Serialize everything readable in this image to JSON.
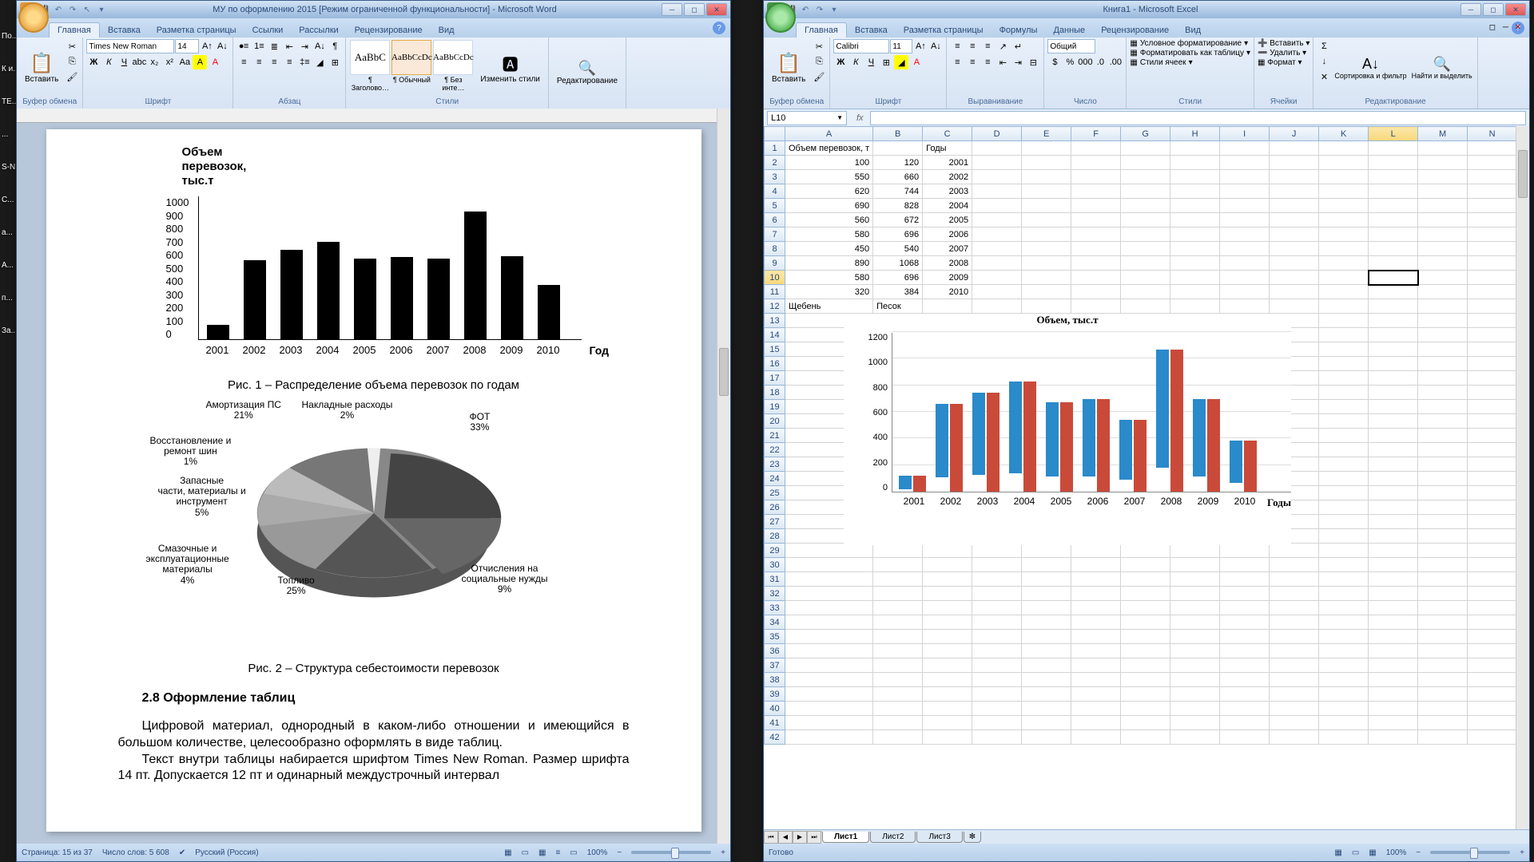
{
  "word": {
    "title": "МУ по оформлению 2015 [Режим ограниченной функциональности] - Microsoft Word",
    "tabs": [
      "Главная",
      "Вставка",
      "Разметка страницы",
      "Ссылки",
      "Рассылки",
      "Рецензирование",
      "Вид"
    ],
    "active_tab": 0,
    "ribbon": {
      "paste": "Вставить",
      "clipboard": "Буфер обмена",
      "font_name": "Times New Roman",
      "font_size": "14",
      "font": "Шрифт",
      "paragraph": "Абзац",
      "styles": "Стили",
      "style_heading": "¶ Заголово…",
      "style_normal": "¶ Обычный",
      "style_nospacing": "¶ Без инте…",
      "change_styles": "Изменить стили",
      "editing": "Редактирование"
    },
    "doc": {
      "chart1_title_lines": [
        "Объем",
        "перевозок,",
        "тыс.т"
      ],
      "chart1_ymax": 1000,
      "chart1_xlabel": "Год",
      "fig1_caption": "Рис. 1 – Распределение объема перевозок по годам",
      "pie_labels": {
        "amort": "Амортизация ПС\n21%",
        "overhead": "Накладные расходы\n2%",
        "fot": "ФОТ\n33%",
        "tires": "Восстановление и\nремонт шин\n1%",
        "parts": "Запасные\nчасти, материалы и\nинструмент\n5%",
        "lube": "Смазочные и\nэксплуатационные\nматериалы\n4%",
        "fuel": "Топливо\n25%",
        "social": "Отчисления на\nсоциальные нужды\n9%"
      },
      "fig2_caption": "Рис. 2 – Структура себестоимости перевозок",
      "section_head": "2.8 Оформление таблиц",
      "para1": "Цифровой материал, однородный в каком-либо отношении и имеющийся в большом количестве, целесообразно оформлять в виде таблиц.",
      "para2": "Текст внутри таблицы набирается шрифтом Times New Roman. Размер шрифта 14 пт. Допускается 12 пт и одинарный междустрочный интервал"
    },
    "status": {
      "page": "Страница: 15 из 37",
      "words": "Число слов: 5 608",
      "lang": "Русский (Россия)",
      "zoom": "100%"
    }
  },
  "excel": {
    "title": "Книга1 - Microsoft Excel",
    "tabs": [
      "Главная",
      "Вставка",
      "Разметка страницы",
      "Формулы",
      "Данные",
      "Рецензирование",
      "Вид"
    ],
    "active_tab": 0,
    "ribbon": {
      "paste": "Вставить",
      "clipboard": "Буфер обмена",
      "font_name": "Calibri",
      "font_size": "11",
      "font": "Шрифт",
      "alignment": "Выравнивание",
      "number_fmt": "Общий",
      "number": "Число",
      "cond_fmt": "Условное форматирование",
      "as_table": "Форматировать как таблицу",
      "cell_styles": "Стили ячеек",
      "styles": "Стили",
      "insert": "Вставить",
      "delete": "Удалить",
      "format": "Формат",
      "cells": "Ячейки",
      "sort_filter": "Сортировка и фильтр",
      "find": "Найти и выделить",
      "editing": "Редактирование"
    },
    "name_box": "L10",
    "headers": {
      "a": "Объем перевозок, т",
      "c": "Годы"
    },
    "row12": {
      "a": "Щебень",
      "b": "Песок"
    },
    "chart_title": "Объем, тыс.т",
    "chart_xlabel": "Годы",
    "sheets": [
      "Лист1",
      "Лист2",
      "Лист3"
    ],
    "status": {
      "ready": "Готово",
      "zoom": "100%"
    }
  },
  "chart_data": [
    {
      "type": "bar",
      "title": "Объем перевозок, тыс.т",
      "categories": [
        "2001",
        "2002",
        "2003",
        "2004",
        "2005",
        "2006",
        "2007",
        "2008",
        "2009",
        "2010"
      ],
      "values": [
        100,
        550,
        620,
        680,
        560,
        570,
        560,
        890,
        580,
        380
      ],
      "xlabel": "Год",
      "ylabel": "",
      "ylim": [
        0,
        1000
      ]
    },
    {
      "type": "pie",
      "title": "Структура себестоимости перевозок",
      "series": [
        {
          "name": "ФОТ",
          "value": 33
        },
        {
          "name": "Отчисления на социальные нужды",
          "value": 9
        },
        {
          "name": "Топливо",
          "value": 25
        },
        {
          "name": "Смазочные и эксплуатационные материалы",
          "value": 4
        },
        {
          "name": "Запасные части, материалы и инструмент",
          "value": 5
        },
        {
          "name": "Восстановление и ремонт шин",
          "value": 1
        },
        {
          "name": "Амортизация ПС",
          "value": 21
        },
        {
          "name": "Накладные расходы",
          "value": 2
        }
      ]
    },
    {
      "type": "bar",
      "title": "Объем, тыс.т",
      "categories": [
        "2001",
        "2002",
        "2003",
        "2004",
        "2005",
        "2006",
        "2007",
        "2008",
        "2009",
        "2010"
      ],
      "series": [
        {
          "name": "Щебень",
          "values": [
            100,
            550,
            620,
            690,
            560,
            580,
            450,
            890,
            580,
            320
          ]
        },
        {
          "name": "Песок",
          "values": [
            120,
            660,
            744,
            828,
            672,
            696,
            540,
            1068,
            696,
            384
          ]
        }
      ],
      "xlabel": "Годы",
      "ylim": [
        0,
        1200
      ]
    }
  ],
  "excel_cells": [
    [
      100,
      120,
      2001
    ],
    [
      550,
      660,
      2002
    ],
    [
      620,
      744,
      2003
    ],
    [
      690,
      828,
      2004
    ],
    [
      560,
      672,
      2005
    ],
    [
      580,
      696,
      2006
    ],
    [
      450,
      540,
      2007
    ],
    [
      890,
      1068,
      2008
    ],
    [
      580,
      696,
      2009
    ],
    [
      320,
      384,
      2010
    ]
  ]
}
